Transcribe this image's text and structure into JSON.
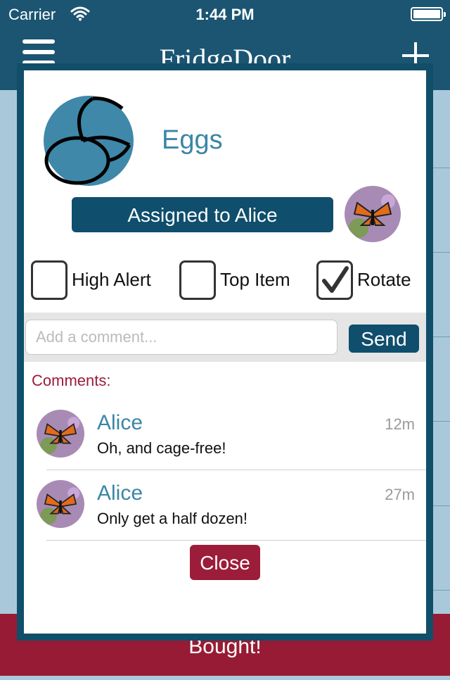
{
  "status_bar": {
    "carrier": "Carrier",
    "time": "1:44 PM"
  },
  "nav": {
    "title": "FridgeDoor"
  },
  "background": {
    "action_label": "Bought!"
  },
  "modal": {
    "item_name": "Eggs",
    "assign_label": "Assigned to Alice",
    "options": [
      {
        "label": "High Alert",
        "checked": false
      },
      {
        "label": "Top Item",
        "checked": false
      },
      {
        "label": "Rotate",
        "checked": true
      }
    ],
    "comment_input": {
      "placeholder": "Add a comment...",
      "value": ""
    },
    "send_label": "Send",
    "comments_heading": "Comments:",
    "comments": [
      {
        "author": "Alice",
        "ago": "12m",
        "text": "Oh, and cage-free!"
      },
      {
        "author": "Alice",
        "ago": "27m",
        "text": "Only get a half dozen!"
      }
    ],
    "close_label": "Close"
  },
  "colors": {
    "brand": "#1b5572",
    "accent_text": "#3b86a6",
    "danger": "#9b1d39"
  }
}
